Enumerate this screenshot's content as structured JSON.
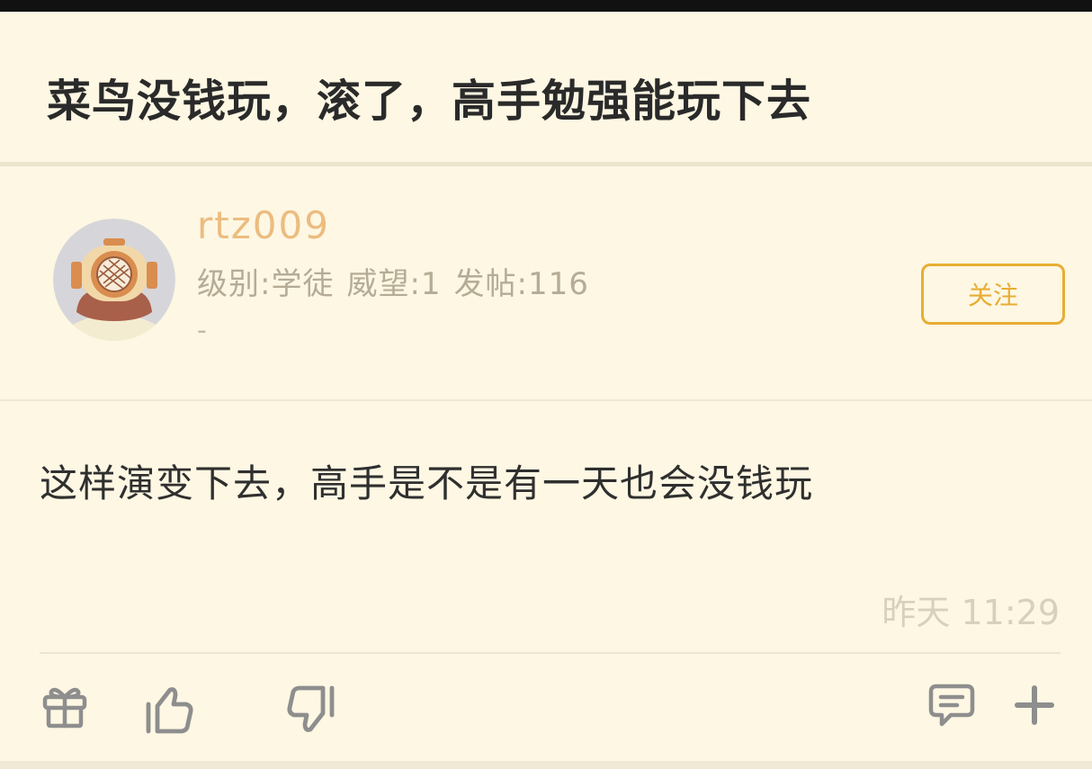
{
  "thread": {
    "title": "菜鸟没钱玩，滚了，高手勉强能玩下去"
  },
  "author": {
    "username": "rtz009",
    "level": "级别:学徒",
    "prestige": "威望:1",
    "posts": "发帖:116",
    "signature": "-",
    "avatar_icon": "diver-helmet-avatar",
    "follow_label": "关注"
  },
  "post": {
    "content": "这样演变下去，高手是不是有一天也会没钱玩",
    "time": "昨天 11:29"
  },
  "actions": {
    "icons": [
      "gift-icon",
      "thumbs-up-icon",
      "thumbs-down-icon",
      "comment-icon",
      "plus-icon"
    ]
  },
  "colors": {
    "background": "#fdf7e3",
    "accent": "#e8ad33",
    "username": "#ecbc7f"
  }
}
